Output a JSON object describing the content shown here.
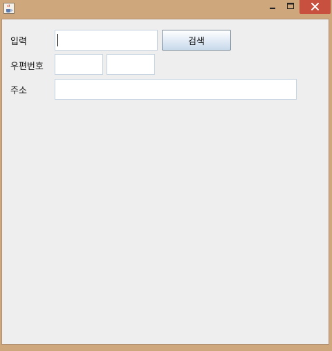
{
  "window": {
    "app_icon": "java-cup-icon",
    "controls": {
      "minimize_icon": "minimize-icon",
      "maximize_icon": "maximize-icon",
      "close_icon": "close-icon"
    }
  },
  "form": {
    "input_label": "입력",
    "input_value": "",
    "search_label": "검색",
    "postal_label": "우편번호",
    "postal_part1": "",
    "postal_part2": "",
    "address_label": "주소",
    "address_value": ""
  },
  "colors": {
    "titlebar": "#cfa77d",
    "close_button": "#c7503f",
    "panel": "#eeeeee"
  }
}
